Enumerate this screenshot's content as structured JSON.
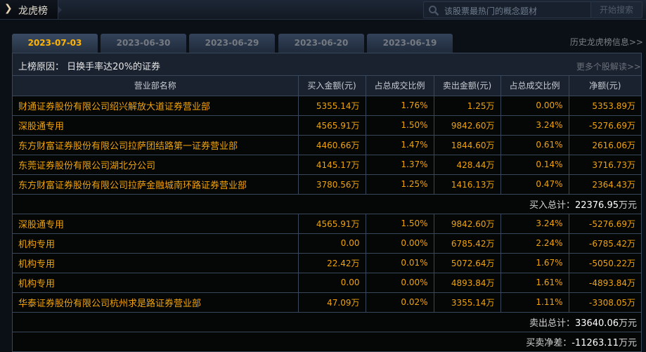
{
  "header": {
    "title": "龙虎榜",
    "search_placeholder": "该股票最热门的概念题材",
    "search_button": "开始搜索"
  },
  "tabs": [
    {
      "label": "2023-07-03",
      "active": true
    },
    {
      "label": "2023-06-30",
      "active": false
    },
    {
      "label": "2023-06-29",
      "active": false
    },
    {
      "label": "2023-06-20",
      "active": false
    },
    {
      "label": "2023-06-19",
      "active": false
    }
  ],
  "history_link": "历史龙虎榜信息>>",
  "reason": {
    "label": "上榜原因：",
    "value": "日换手率达20%的证券",
    "more_link": "更多个股解读>>"
  },
  "table": {
    "headers": [
      "营业部名称",
      "买入金额(元)",
      "占总成交比例",
      "卖出金额(元)",
      "占总成交比例",
      "净额(元)"
    ],
    "buy_rows": [
      [
        "财通证券股份有限公司绍兴解放大道证券营业部",
        "5355.14万",
        "1.76%",
        "1.25万",
        "0.00%",
        "5353.89万"
      ],
      [
        "深股通专用",
        "4565.91万",
        "1.50%",
        "9842.60万",
        "3.24%",
        "-5276.69万"
      ],
      [
        "东方财富证券股份有限公司拉萨团结路第一证券营业部",
        "4460.66万",
        "1.47%",
        "1844.60万",
        "0.61%",
        "2616.06万"
      ],
      [
        "东莞证券股份有限公司湖北分公司",
        "4145.17万",
        "1.37%",
        "428.44万",
        "0.14%",
        "3716.73万"
      ],
      [
        "东方财富证券股份有限公司拉萨金融城南环路证券营业部",
        "3780.56万",
        "1.25%",
        "1416.13万",
        "0.47%",
        "2364.43万"
      ]
    ],
    "buy_total": {
      "label": "买入总计：",
      "value": "22376.95",
      "unit": "万元"
    },
    "sell_rows": [
      [
        "深股通专用",
        "4565.91万",
        "1.50%",
        "9842.60万",
        "3.24%",
        "-5276.69万"
      ],
      [
        "机构专用",
        "0.00",
        "0.00%",
        "6785.42万",
        "2.24%",
        "-6785.42万"
      ],
      [
        "机构专用",
        "22.42万",
        "0.01%",
        "5072.64万",
        "1.67%",
        "-5050.22万"
      ],
      [
        "机构专用",
        "0.00",
        "0.00%",
        "4893.84万",
        "1.61%",
        "-4893.84万"
      ],
      [
        "华泰证券股份有限公司杭州求是路证券营业部",
        "47.09万",
        "0.02%",
        "3355.14万",
        "1.11%",
        "-3308.05万"
      ]
    ],
    "sell_total": {
      "label": "卖出总计：",
      "value": "33640.06",
      "unit": "万元"
    },
    "net": {
      "label": "买卖净差：",
      "value": "-11263.11",
      "unit": "万元"
    }
  }
}
